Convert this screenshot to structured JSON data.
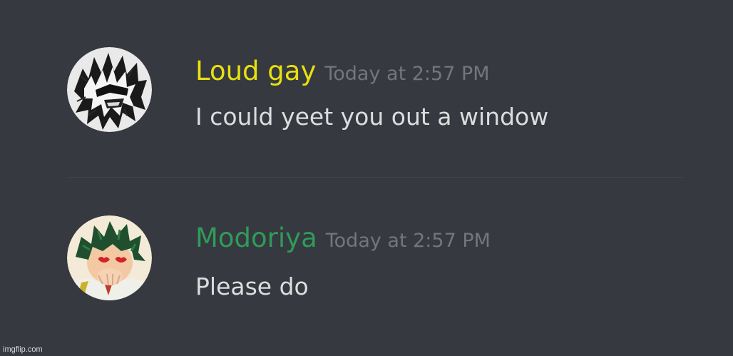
{
  "colors": {
    "background": "#36393f",
    "divider": "#42454a",
    "timestamp": "#72767d",
    "message_text": "#dcddde"
  },
  "messages": [
    {
      "username": "Loud gay",
      "username_color": "#e8e011",
      "timestamp": "Today at 2:57 PM",
      "text": "I could yeet you out a window",
      "avatar_icon": "manga-character-avatar"
    },
    {
      "username": "Modoriya",
      "username_color": "#2f9b5a",
      "timestamp": "Today at 2:57 PM",
      "text": "Please do",
      "avatar_icon": "green-haired-character-avatar"
    }
  ],
  "watermark": "imgflip.com"
}
